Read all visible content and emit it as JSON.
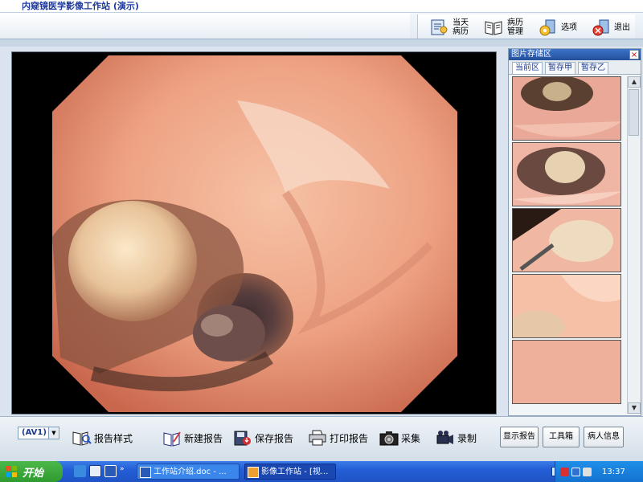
{
  "window": {
    "title": "内窥镜医学影像工作站 (演示)"
  },
  "toolbar": {
    "buttons": [
      {
        "label": "当天病历",
        "icon": "patient-record-icon"
      },
      {
        "label": "病历管理",
        "icon": "book-icon"
      },
      {
        "label": "选项",
        "icon": "options-icon"
      },
      {
        "label": "退出",
        "icon": "exit-icon"
      }
    ]
  },
  "storage": {
    "title": "图片存储区",
    "close": "×",
    "tabs": [
      {
        "label": "当前区",
        "active": true
      },
      {
        "label": "暂存甲",
        "active": false
      },
      {
        "label": "暂存乙",
        "active": false
      }
    ]
  },
  "bottom": {
    "source_select": "(AV1)",
    "buttons": {
      "report_style": "报告样式",
      "new_report": "新建报告",
      "save_report": "保存报告",
      "print_report": "打印报告",
      "capture": "采集",
      "record": "录制"
    },
    "right_buttons": {
      "show_report": "显示报告",
      "toolbox": "工具箱",
      "patient_info": "病人信息"
    }
  },
  "taskbar": {
    "start": "开始",
    "tasks": [
      {
        "label": "工作站介绍.doc - ..."
      },
      {
        "label": "影像工作站 - [视..."
      }
    ],
    "clock": "13:37"
  },
  "colors": {
    "accent": "#245ed7",
    "title_text": "#1e3aa0",
    "panel_header": "#3c73c8"
  }
}
